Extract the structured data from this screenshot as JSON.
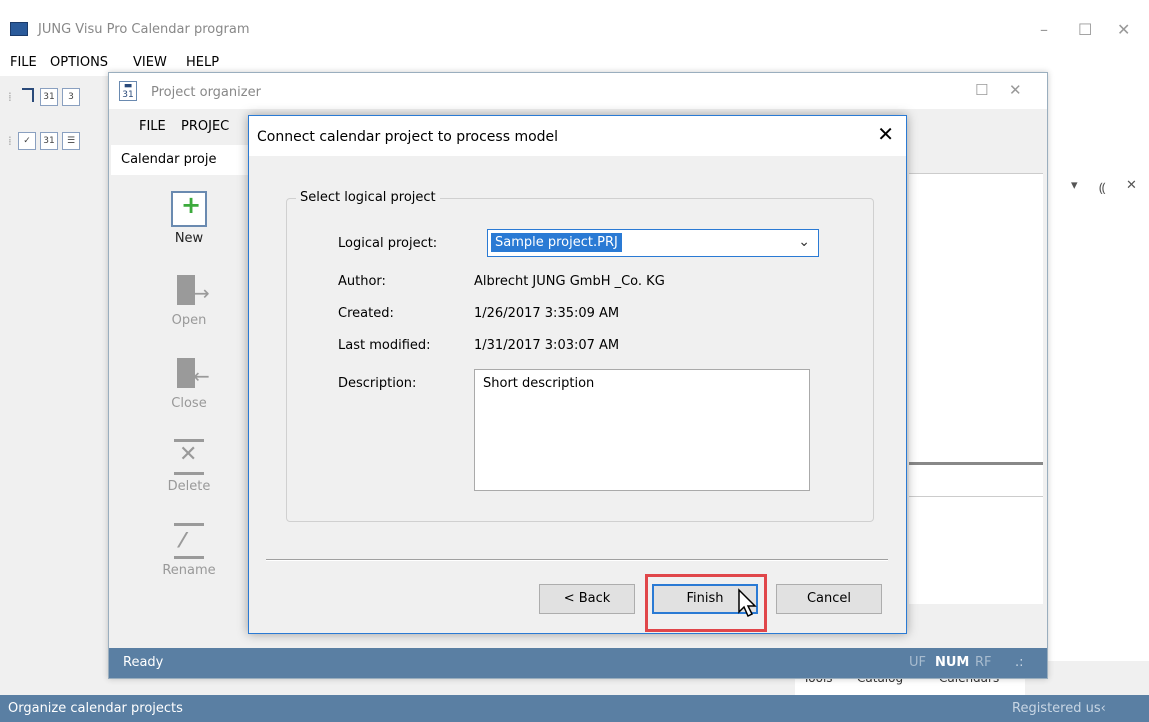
{
  "main_window": {
    "title": "JUNG Visu Pro Calendar program",
    "controls": {
      "minimize": "–",
      "maximize": "☐",
      "close": "✕"
    },
    "menu": [
      "FILE",
      "OPTIONS",
      "VIEW",
      "HELP"
    ],
    "status_left": "Organize calendar projects",
    "status_right": "Registered us‹",
    "bottom_tabs": [
      "Tools",
      "Catalog",
      "Calendars"
    ],
    "pane_controls": {
      "dropdown": "▾",
      "pin": "⸨",
      "close": "✕"
    }
  },
  "organizer": {
    "title": "Project organizer",
    "menu": [
      "FILE",
      "PROJEC"
    ],
    "tab": "Calendar proje",
    "side_buttons": [
      {
        "label": "New",
        "icon": "new-icon",
        "enabled": true
      },
      {
        "label": "Open",
        "icon": "open-icon",
        "enabled": false
      },
      {
        "label": "Close",
        "icon": "close-project-icon",
        "enabled": false
      },
      {
        "label": "Delete",
        "icon": "delete-icon",
        "enabled": false
      },
      {
        "label": "Rename",
        "icon": "rename-icon",
        "enabled": false
      }
    ],
    "status_left": "Ready",
    "status_right": {
      "uf": "UF",
      "num": "NUM",
      "rf": "RF",
      "grip": ".:"
    }
  },
  "dialog": {
    "title": "Connect calendar project to process model",
    "close": "✕",
    "group_title": "Select logical project",
    "fields": {
      "logical_project_label": "Logical project:",
      "logical_project_value": "Sample project.PRJ",
      "author_label": "Author:",
      "author_value": "Albrecht JUNG GmbH _Co. KG",
      "created_label": "Created:",
      "created_value": "1/26/2017 3:35:09 AM",
      "modified_label": "Last modified:",
      "modified_value": "1/31/2017 3:03:07 AM",
      "description_label": "Description:",
      "description_value": "Short description"
    },
    "buttons": {
      "back": "< Back",
      "finish": "Finish",
      "cancel": "Cancel"
    },
    "accent": "#2a7ad4",
    "highlight_color": "#e0464a"
  },
  "colors": {
    "status_bar": "#5a7fa3"
  }
}
